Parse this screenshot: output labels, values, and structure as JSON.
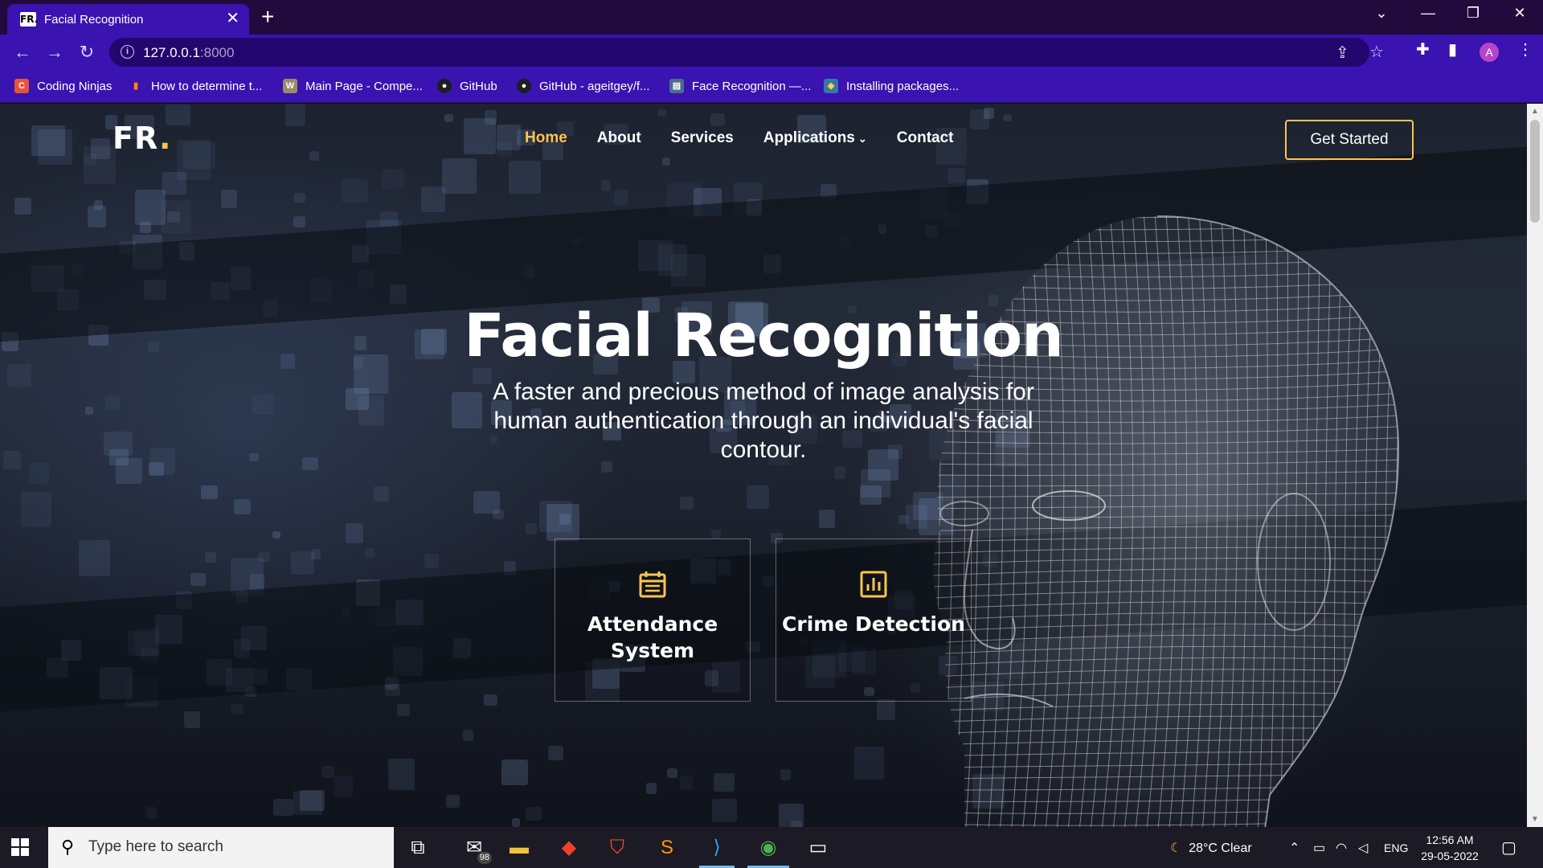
{
  "browser": {
    "tab": {
      "favicon": "FR.",
      "title": "Facial Recognition",
      "close": "✕"
    },
    "url": {
      "host": "127.0.0.1",
      "port": ":8000"
    },
    "profile_initial": "A",
    "bookmarks": [
      {
        "label": "Coding Ninjas",
        "icon": "coding-ninjas-icon",
        "color": "#e8533b"
      },
      {
        "label": "How to determine t...",
        "icon": "bar-chart-icon",
        "color": "#ff8a00"
      },
      {
        "label": "Main Page - Compe...",
        "icon": "wiki-icon",
        "color": "#9a8a6a"
      },
      {
        "label": "GitHub",
        "icon": "github-icon",
        "color": "#1b1f23"
      },
      {
        "label": "GitHub - ageitgey/f...",
        "icon": "github-icon",
        "color": "#1b1f23"
      },
      {
        "label": "Face Recognition —...",
        "icon": "docs-icon",
        "color": "#4b6b8f"
      },
      {
        "label": "Installing packages...",
        "icon": "python-icon",
        "color": "#3776ab"
      }
    ]
  },
  "site": {
    "logo_text": "FR",
    "logo_dot": ".",
    "accent_color": "#ffc451",
    "menu": [
      {
        "label": "Home",
        "active": true
      },
      {
        "label": "About"
      },
      {
        "label": "Services"
      },
      {
        "label": "Applications",
        "dropdown": true
      },
      {
        "label": "Contact"
      }
    ],
    "cta_label": "Get Started",
    "hero": {
      "title": "Facial Recognition",
      "subtitle": "A faster and precious method of image analysis for human authentication through an individual's facial contour."
    },
    "cards": [
      {
        "title": "Attendance System",
        "icon": "calendar-icon"
      },
      {
        "title": "Crime Detection",
        "icon": "bar-chart-icon"
      }
    ]
  },
  "taskbar": {
    "search_placeholder": "Type here to search",
    "mail_badge": "98",
    "weather": "28°C  Clear",
    "language": "ENG",
    "time": "12:56 AM",
    "date": "29-05-2022"
  }
}
